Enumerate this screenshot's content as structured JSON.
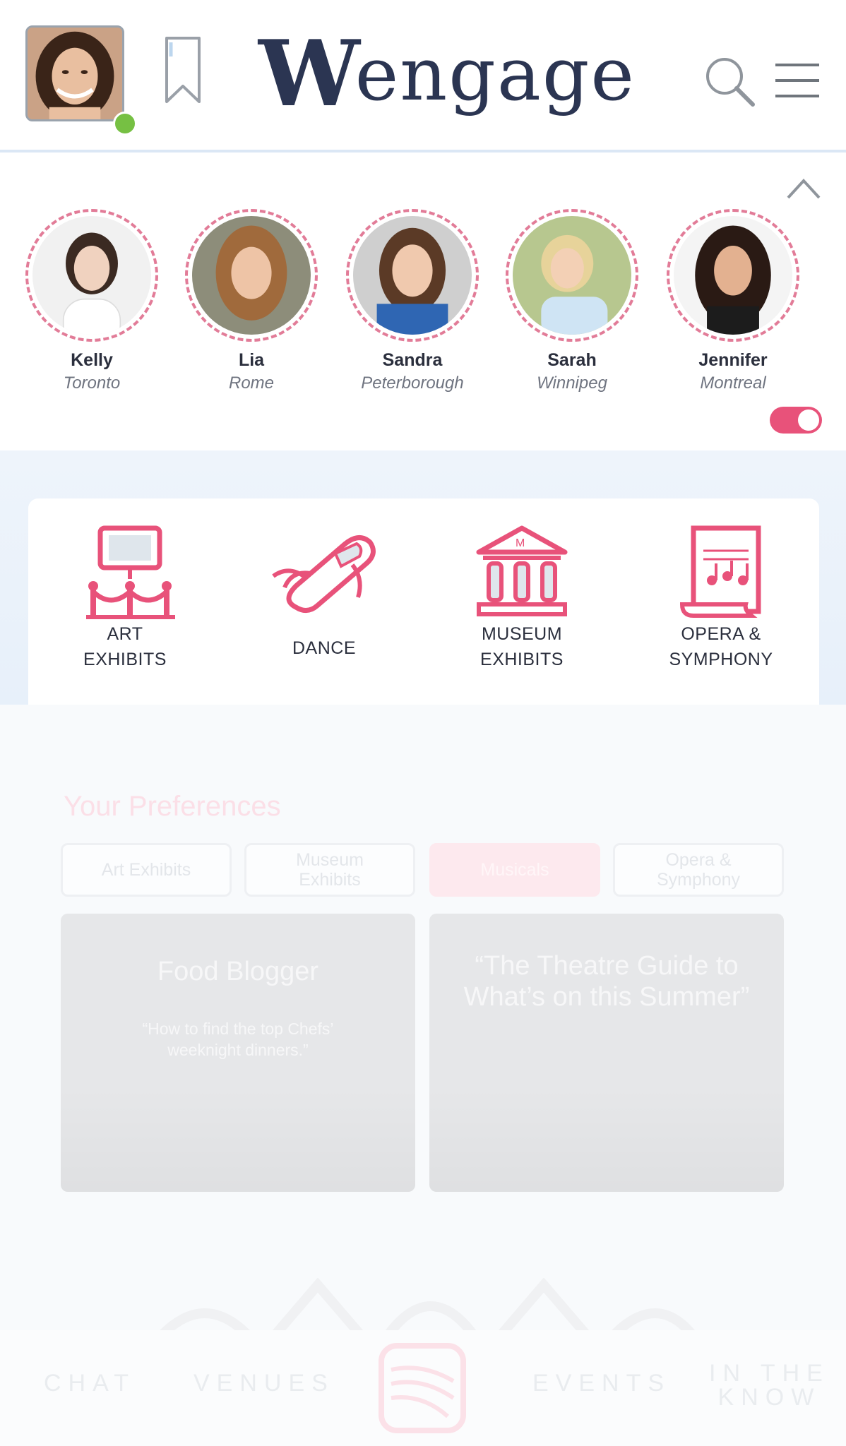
{
  "header": {
    "logo_w": "W",
    "logo_rest": "engage",
    "icons": {
      "bookmark": "bookmark-icon",
      "search": "search-icon",
      "menu": "hamburger-menu-icon"
    }
  },
  "user": {
    "status": "online",
    "status_color": "#76c043"
  },
  "matches": [
    {
      "name": "Kelly",
      "city": "Toronto"
    },
    {
      "name": "Lia",
      "city": "Rome"
    },
    {
      "name": "Sandra",
      "city": "Peterborough"
    },
    {
      "name": "Sarah",
      "city": "Winnipeg"
    },
    {
      "name": "Jennifer",
      "city": "Montreal"
    }
  ],
  "toggle": {
    "on": true,
    "color": "#e8527a"
  },
  "categories": [
    {
      "line1": "ART",
      "line2": "EXHIBITS",
      "icon": "art-exhibit-icon"
    },
    {
      "line1": "DANCE",
      "line2": "",
      "icon": "ballet-shoe-icon"
    },
    {
      "line1": "MUSEUM",
      "line2": "EXHIBITS",
      "icon": "museum-icon"
    },
    {
      "line1": "OPERA &",
      "line2": "SYMPHONY",
      "icon": "sheet-music-icon"
    }
  ],
  "preferences": {
    "title": "Your Preferences",
    "chips": [
      {
        "line1": "Art Exhibits",
        "line2": ""
      },
      {
        "line1": "Museum",
        "line2": "Exhibits"
      },
      {
        "line1": "Musicals",
        "line2": ""
      },
      {
        "line1": "Opera &",
        "line2": "Symphony"
      }
    ],
    "active": "Musicals"
  },
  "tiles": [
    {
      "title": "Food Blogger",
      "subtitle": "“How to find the top Chefs’ weeknight dinners.”"
    },
    {
      "title": "“The Theatre Guide to What’s on this Summer”",
      "subtitle": ""
    }
  ],
  "bottom_nav": {
    "chat": "CHAT",
    "venues": "VENUES",
    "events": "EVENTS",
    "in_the": "IN THE",
    "know": "KNOW"
  },
  "colors": {
    "accent": "#e8527a",
    "navy": "#2b3552",
    "ring": "#e27c98"
  }
}
